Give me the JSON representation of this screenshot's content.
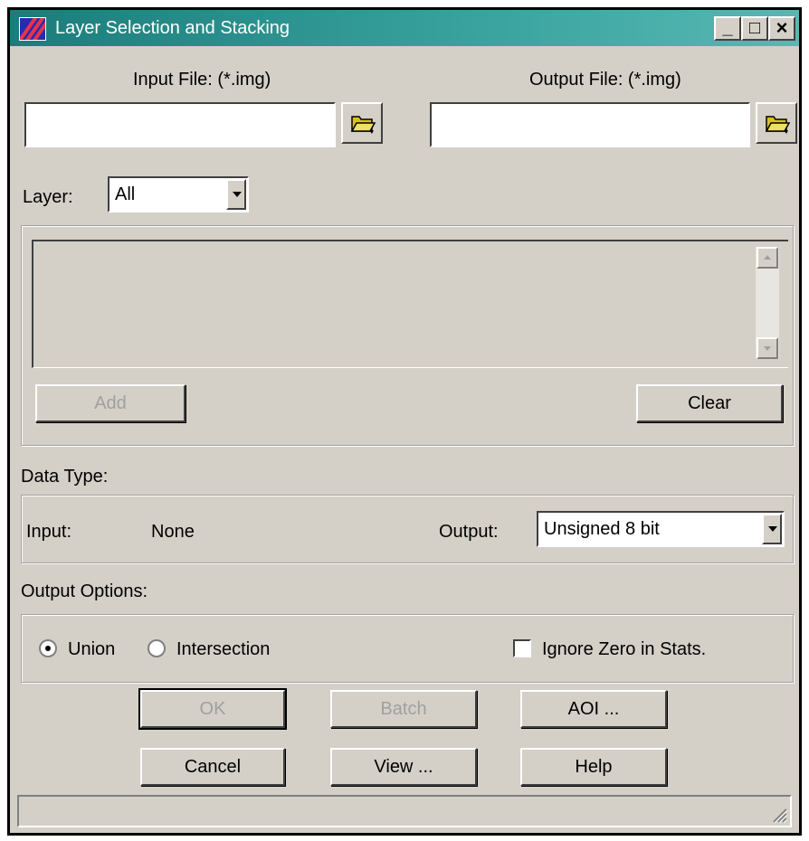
{
  "window": {
    "title": "Layer Selection and Stacking"
  },
  "title_buttons": {
    "minimize": "_",
    "maximize": "□",
    "close": "×"
  },
  "files": {
    "input_label": "Input File: (*.img)",
    "input_value": "",
    "output_label": "Output File: (*.img)",
    "output_value": ""
  },
  "layer": {
    "label": "Layer:",
    "selected": "All"
  },
  "layer_list": {
    "items": [],
    "add_label": "Add",
    "clear_label": "Clear"
  },
  "data_type": {
    "heading": "Data Type:",
    "input_label": "Input:",
    "input_value": "None",
    "output_label": "Output:",
    "output_selected": "Unsigned 8 bit"
  },
  "output_options": {
    "heading": "Output Options:",
    "union_label": "Union",
    "union_selected": true,
    "intersection_label": "Intersection",
    "ignore_zero_label": "Ignore Zero in Stats.",
    "ignore_zero_checked": false
  },
  "buttons": {
    "ok": "OK",
    "batch": "Batch",
    "aoi": "AOI ...",
    "cancel": "Cancel",
    "view": "View ...",
    "help": "Help"
  },
  "icons": {
    "app": "erdas-imagine-icon",
    "input_browse": "open-folder-icon",
    "output_browse": "open-folder-icon"
  },
  "colors": {
    "title_bar": "#1b7d7b",
    "dialog_face": "#d4d0c8"
  }
}
